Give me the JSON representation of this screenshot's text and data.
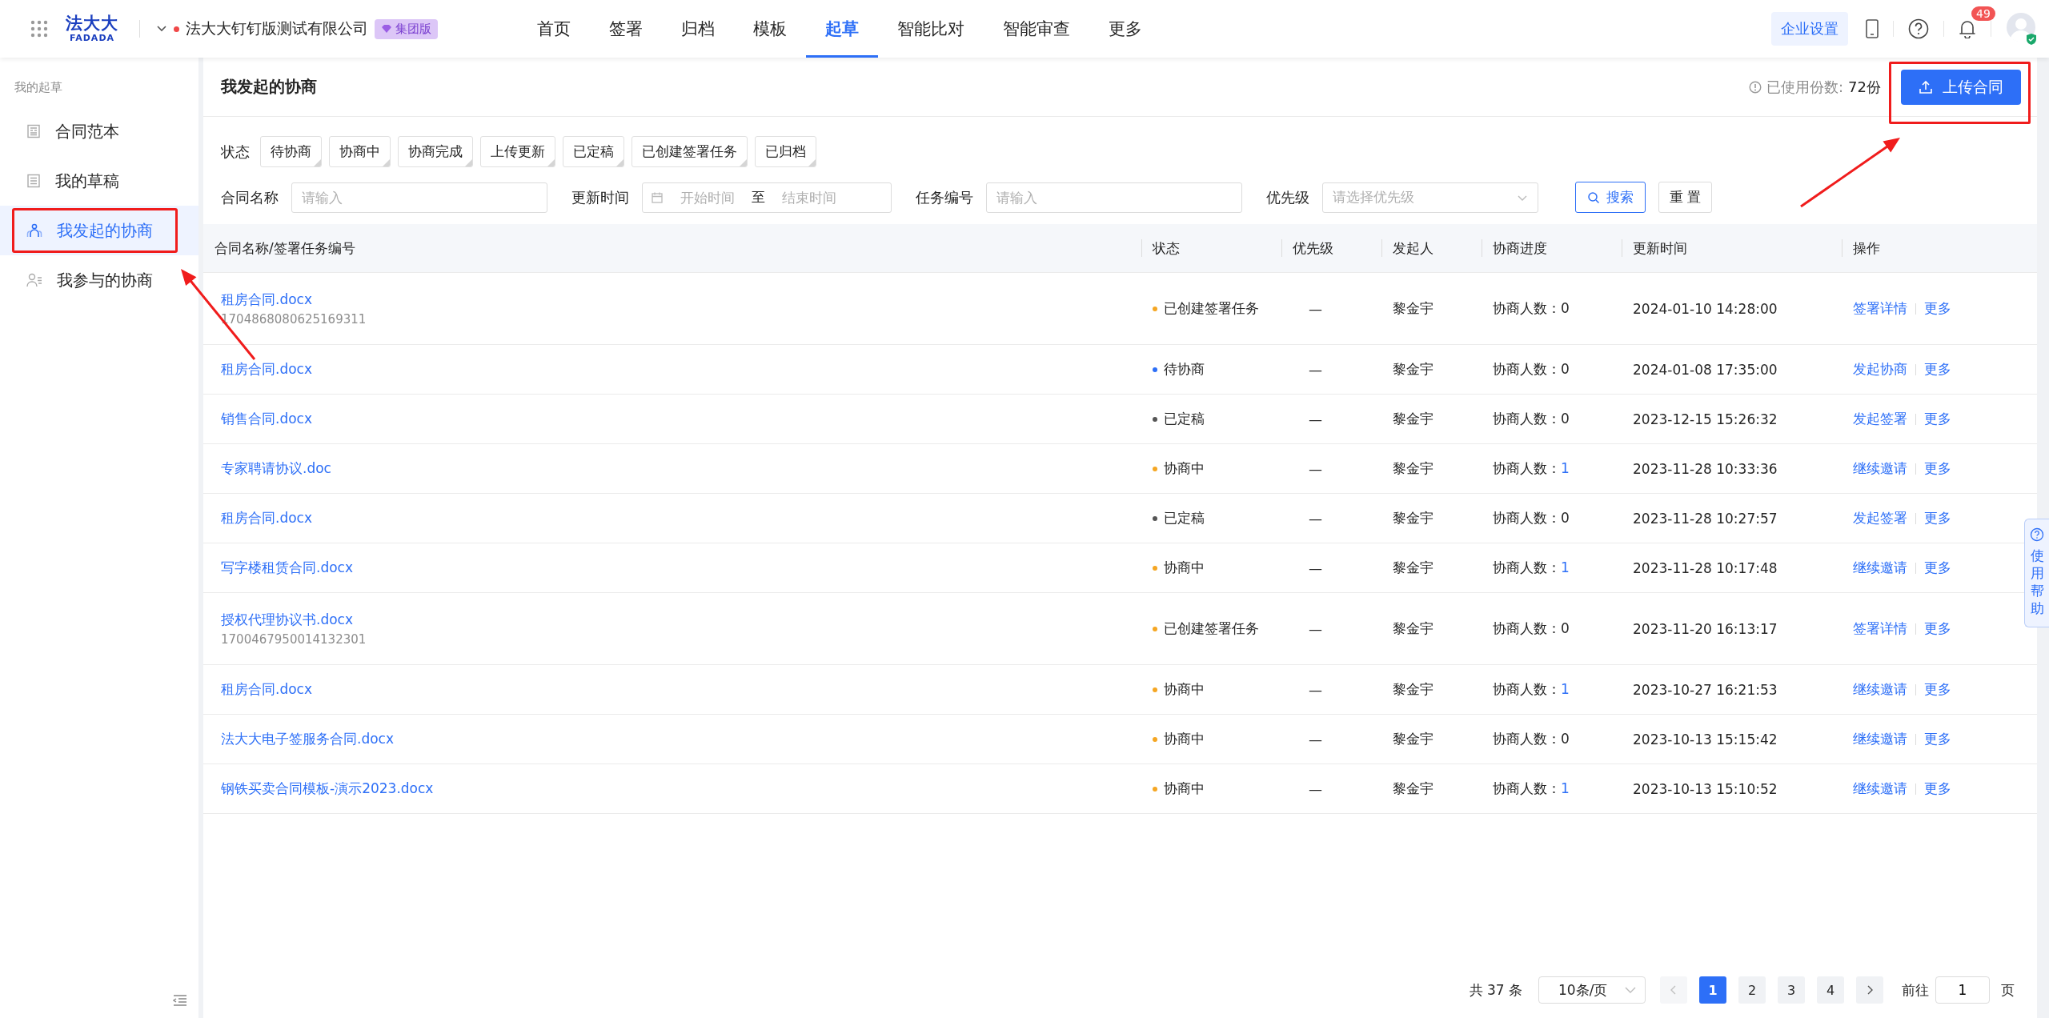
{
  "header": {
    "logo_top": "法大大",
    "logo_bottom": "FADADA",
    "org_name": "法大大钉钉版测试有限公司",
    "org_badge": "集团版",
    "nav": [
      {
        "label": "首页",
        "selected": false
      },
      {
        "label": "签署",
        "selected": false
      },
      {
        "label": "归档",
        "selected": false
      },
      {
        "label": "模板",
        "selected": false
      },
      {
        "label": "起草",
        "selected": true
      },
      {
        "label": "智能比对",
        "selected": false
      },
      {
        "label": "智能审查",
        "selected": false
      },
      {
        "label": "更多",
        "selected": false
      }
    ],
    "settings_button": "企业设置",
    "notification_count": "49"
  },
  "sidebar": {
    "section_title": "我的起草",
    "items": [
      {
        "label": "合同范本",
        "kind": "template",
        "selected": false,
        "highlighted": false
      },
      {
        "label": "我的草稿",
        "kind": "draft",
        "selected": false,
        "highlighted": false
      },
      {
        "label": "我发起的协商",
        "kind": "group",
        "selected": true,
        "highlighted": true
      },
      {
        "label": "我参与的协商",
        "kind": "person",
        "selected": false,
        "highlighted": false
      }
    ]
  },
  "page": {
    "title": "我发起的协商",
    "usage_label": "已使用份数:",
    "usage_value": "72份",
    "upload_button": "上传合同",
    "upload_highlighted": true
  },
  "filters": {
    "status_label": "状态",
    "statuses": [
      {
        "label": "待协商",
        "selected": false
      },
      {
        "label": "协商中",
        "selected": false
      },
      {
        "label": "协商完成",
        "selected": false
      },
      {
        "label": "上传更新",
        "selected": false
      },
      {
        "label": "已定稿",
        "selected": false
      },
      {
        "label": "已创建签署任务",
        "selected": false
      },
      {
        "label": "已归档",
        "selected": false
      }
    ],
    "fields": [
      {
        "kind": "text",
        "label": "合同名称",
        "placeholder": "请输入"
      },
      {
        "kind": "daterange",
        "label": "更新时间",
        "start_placeholder": "开始时间",
        "separator": "至",
        "end_placeholder": "结束时间"
      },
      {
        "kind": "text",
        "label": "任务编号",
        "placeholder": "请输入"
      },
      {
        "kind": "select",
        "label": "优先级",
        "placeholder": "请选择优先级"
      }
    ],
    "search_button": "搜索",
    "reset_button": "重 置"
  },
  "table": {
    "columns": [
      "合同名称/签署任务编号",
      "状态",
      "优先级",
      "发起人",
      "协商进度",
      "更新时间",
      "操作"
    ],
    "rows": [
      {
        "name": "租房合同.docx",
        "task_id": "1704868080625169311",
        "status": "已创建签署任务",
        "color": "#f5a623",
        "priority": "—",
        "initiator": "黎金宇",
        "progress_label": "协商人数：",
        "progress_count": "0",
        "progress_link": false,
        "updated": "2024-01-10 14:28:00",
        "actions": [
          "签署详情",
          "更多"
        ]
      },
      {
        "name": "租房合同.docx",
        "status": "待协商",
        "color": "#2d6ff7",
        "priority": "—",
        "initiator": "黎金宇",
        "progress_label": "协商人数：",
        "progress_count": "0",
        "progress_link": false,
        "updated": "2024-01-08 17:35:00",
        "actions": [
          "发起协商",
          "更多"
        ]
      },
      {
        "name": "销售合同.docx",
        "status": "已定稿",
        "color": "#555555",
        "priority": "—",
        "initiator": "黎金宇",
        "progress_label": "协商人数：",
        "progress_count": "0",
        "progress_link": false,
        "updated": "2023-12-15 15:26:32",
        "actions": [
          "发起签署",
          "更多"
        ]
      },
      {
        "name": "专家聘请协议.doc",
        "status": "协商中",
        "color": "#f5a623",
        "priority": "—",
        "initiator": "黎金宇",
        "progress_label": "协商人数：",
        "progress_count": "1",
        "progress_link": true,
        "updated": "2023-11-28 10:33:36",
        "actions": [
          "继续邀请",
          "更多"
        ]
      },
      {
        "name": "租房合同.docx",
        "status": "已定稿",
        "color": "#555555",
        "priority": "—",
        "initiator": "黎金宇",
        "progress_label": "协商人数：",
        "progress_count": "0",
        "progress_link": false,
        "updated": "2023-11-28 10:27:57",
        "actions": [
          "发起签署",
          "更多"
        ]
      },
      {
        "name": "写字楼租赁合同.docx",
        "status": "协商中",
        "color": "#f5a623",
        "priority": "—",
        "initiator": "黎金宇",
        "progress_label": "协商人数：",
        "progress_count": "1",
        "progress_link": true,
        "updated": "2023-11-28 10:17:48",
        "actions": [
          "继续邀请",
          "更多"
        ]
      },
      {
        "name": "授权代理协议书.docx",
        "task_id": "1700467950014132301",
        "status": "已创建签署任务",
        "color": "#f5a623",
        "priority": "—",
        "initiator": "黎金宇",
        "progress_label": "协商人数：",
        "progress_count": "0",
        "progress_link": false,
        "updated": "2023-11-20 16:13:17",
        "actions": [
          "签署详情",
          "更多"
        ]
      },
      {
        "name": "租房合同.docx",
        "status": "协商中",
        "color": "#f5a623",
        "priority": "—",
        "initiator": "黎金宇",
        "progress_label": "协商人数：",
        "progress_count": "1",
        "progress_link": true,
        "updated": "2023-10-27 16:21:53",
        "actions": [
          "继续邀请",
          "更多"
        ]
      },
      {
        "name": "法大大电子签服务合同.docx",
        "status": "协商中",
        "color": "#f5a623",
        "priority": "—",
        "initiator": "黎金宇",
        "progress_label": "协商人数：",
        "progress_count": "0",
        "progress_link": false,
        "updated": "2023-10-13 15:15:42",
        "actions": [
          "继续邀请",
          "更多"
        ]
      },
      {
        "name": "钢铁买卖合同模板-演示2023.docx",
        "status": "协商中",
        "color": "#f5a623",
        "priority": "—",
        "initiator": "黎金宇",
        "progress_label": "协商人数：",
        "progress_count": "1",
        "progress_link": true,
        "updated": "2023-10-13 15:10:52",
        "actions": [
          "继续邀请",
          "更多"
        ]
      }
    ]
  },
  "pagination": {
    "total": "共 37 条",
    "page_size": "10条/页",
    "pages": [
      {
        "label": "1",
        "selected": true
      },
      {
        "label": "2",
        "selected": false
      },
      {
        "label": "3",
        "selected": false
      },
      {
        "label": "4",
        "selected": false
      }
    ],
    "goto_label": "前往",
    "goto_value": "1",
    "page_suffix": "页"
  },
  "help_tab": "使用帮助"
}
